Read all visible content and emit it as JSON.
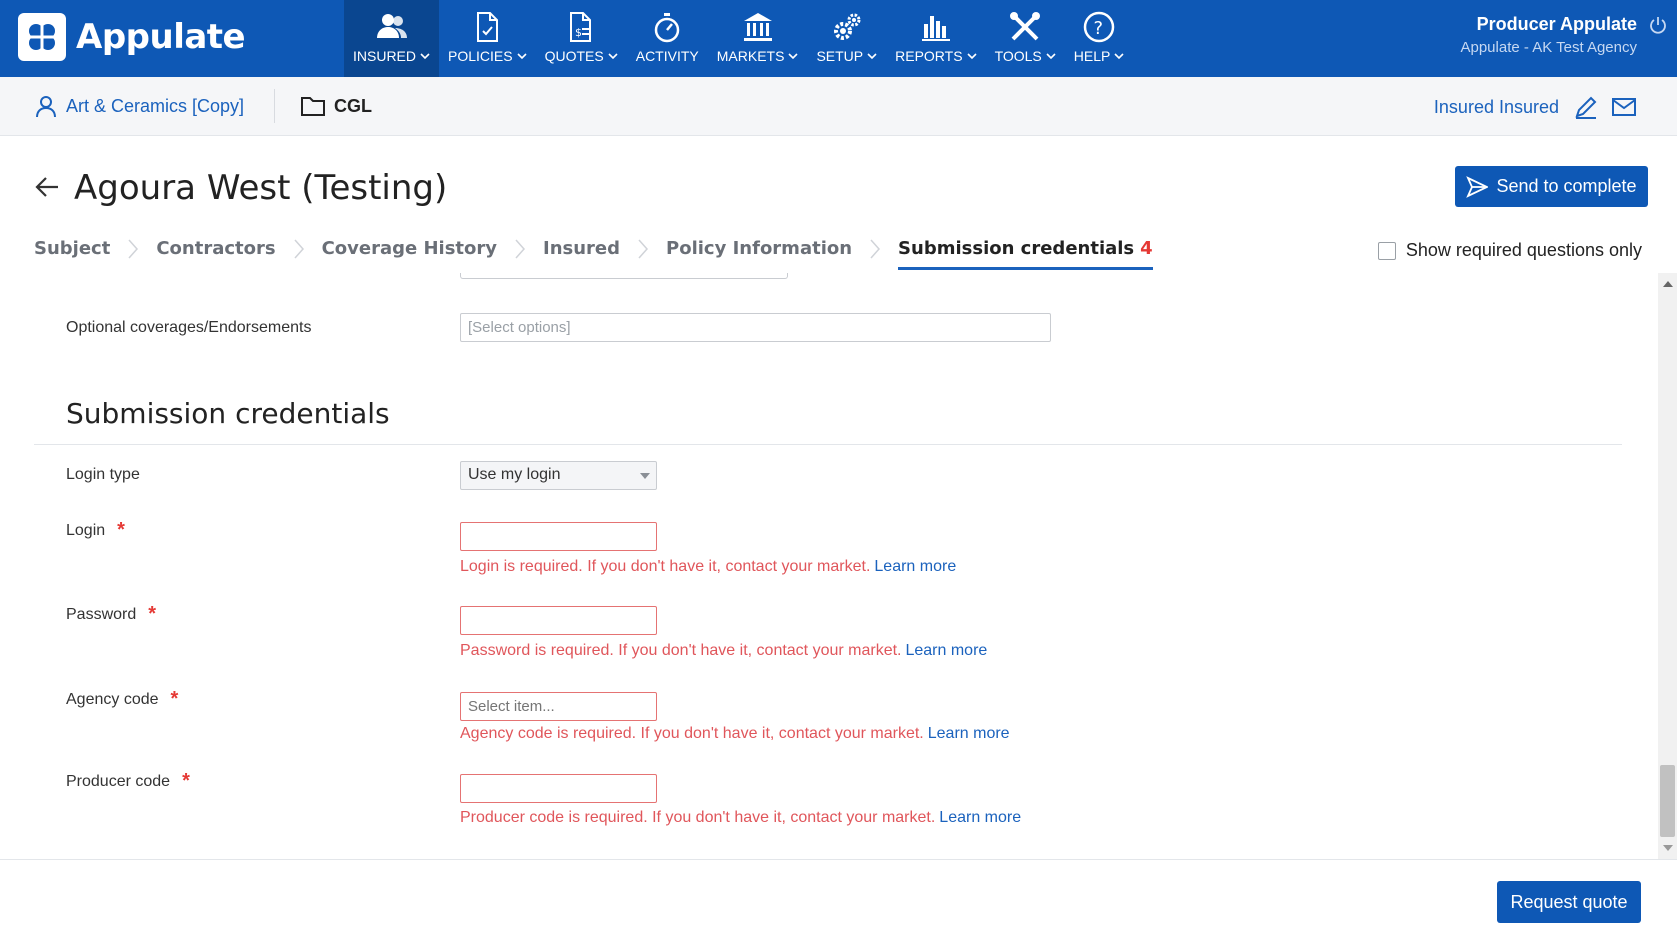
{
  "app": {
    "name": "Appulate"
  },
  "nav": {
    "items": [
      {
        "label": "INSURED",
        "icon": "insured-icon",
        "dropdown": true,
        "active": true
      },
      {
        "label": "POLICIES",
        "icon": "policies-icon",
        "dropdown": true
      },
      {
        "label": "QUOTES",
        "icon": "quotes-icon",
        "dropdown": true
      },
      {
        "label": "ACTIVITY",
        "icon": "activity-icon",
        "dropdown": false
      },
      {
        "label": "MARKETS",
        "icon": "markets-icon",
        "dropdown": true
      },
      {
        "label": "SETUP",
        "icon": "setup-icon",
        "dropdown": true
      },
      {
        "label": "REPORTS",
        "icon": "reports-icon",
        "dropdown": true
      },
      {
        "label": "TOOLS",
        "icon": "tools-icon",
        "dropdown": true
      },
      {
        "label": "HELP",
        "icon": "help-icon",
        "dropdown": true
      }
    ]
  },
  "user": {
    "name": "Producer Appulate",
    "agency": "Appulate - AK Test Agency"
  },
  "subheader": {
    "client": "Art & Ceramics [Copy]",
    "lob": "CGL",
    "insured_link": "Insured Insured"
  },
  "page": {
    "title": "Agoura West (Testing)",
    "send_button": "Send to complete"
  },
  "steps": [
    {
      "label": "Subject"
    },
    {
      "label": "Contractors"
    },
    {
      "label": "Coverage History"
    },
    {
      "label": "Insured"
    },
    {
      "label": "Policy Information"
    },
    {
      "label": "Submission credentials",
      "badge": "4",
      "active": true
    }
  ],
  "required_toggle": {
    "label": "Show required questions only",
    "checked": false
  },
  "form": {
    "optional_coverages": {
      "label": "Optional coverages/Endorsements",
      "placeholder": "[Select options]"
    },
    "section_title": "Submission credentials",
    "login_type": {
      "label": "Login type",
      "value": "Use my login"
    },
    "login": {
      "label": "Login",
      "required": "*",
      "error": "Login is required. If you don't have it, contact your market.",
      "link": "Learn more"
    },
    "password": {
      "label": "Password",
      "required": "*",
      "error": "Password is required. If you don't have it, contact your market.",
      "link": "Learn more"
    },
    "agency_code": {
      "label": "Agency code",
      "required": "*",
      "placeholder": "Select item...",
      "error": "Agency code is required. If you don't have it, contact your market.",
      "link": "Learn more"
    },
    "producer_code": {
      "label": "Producer code",
      "required": "*",
      "error": "Producer code is required. If you don't have it, contact your market.",
      "link": "Learn more"
    }
  },
  "footer": {
    "request_button": "Request quote"
  },
  "colors": {
    "primary": "#0e58b5",
    "error": "#e0565b",
    "link": "#1b62bd"
  }
}
